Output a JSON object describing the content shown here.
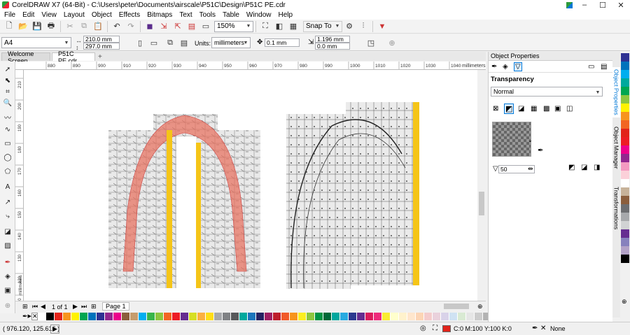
{
  "window": {
    "title": "CorelDRAW X7 (64-Bit) - C:\\Users\\peter\\Documents\\airscale\\P51C\\Design\\P51C PE.cdr"
  },
  "menu": [
    "File",
    "Edit",
    "View",
    "Layout",
    "Object",
    "Effects",
    "Bitmaps",
    "Text",
    "Tools",
    "Table",
    "Window",
    "Help"
  ],
  "toolbar": {
    "zoom": "150%",
    "snap_label": "Snap To"
  },
  "property_bar": {
    "page_size": "A4",
    "width": "210.0 mm",
    "height": "297.0 mm",
    "units_label": "Units:",
    "units": "millimeters",
    "nudge": "0.1 mm",
    "dup_x": "1.196 mm",
    "dup_y": "0.0 mm"
  },
  "tabs": [
    "Welcome Screen",
    "P51C PE.cdr"
  ],
  "ruler": {
    "h_labels": [
      "880",
      "890",
      "900",
      "910",
      "920",
      "930",
      "940",
      "950",
      "960",
      "970",
      "980",
      "990",
      "1000",
      "1010",
      "1020",
      "1030",
      "1040"
    ],
    "h_unit": "millimeters",
    "v_labels": [
      "210",
      "200",
      "190",
      "180",
      "170",
      "160",
      "150",
      "140",
      "130",
      "120",
      "110"
    ],
    "v_unit": "millimeters"
  },
  "page_nav": {
    "counter": "1 of 1",
    "page_tab": "Page 1"
  },
  "status": {
    "coords": "( 976.120, 125.616 )",
    "fill": "C:0 M:100 Y:100 K:0",
    "outline": "None"
  },
  "docker": {
    "title": "Object Properties",
    "section": "Transparency",
    "mode": "Normal",
    "opacity": "50"
  },
  "side_tabs": [
    "Object Properties",
    "Object Manager",
    "Transformations"
  ],
  "palette_bottom": [
    "#ffffff",
    "#000000",
    "#e2231a",
    "#f7941d",
    "#fff200",
    "#00a651",
    "#0072bc",
    "#2e3192",
    "#92278f",
    "#ec008c",
    "#8b5e3c",
    "#c69c6d",
    "#00aeef",
    "#39b54a",
    "#8dc63f",
    "#f26522",
    "#ed1c24",
    "#662d91",
    "#d7df23",
    "#fbb040",
    "#ffde17",
    "#a7a9ac",
    "#808285",
    "#58595b",
    "#00a99d",
    "#1b75bc",
    "#262262",
    "#9e1f63",
    "#be1e2d",
    "#f15a29",
    "#f7941d",
    "#fcee21",
    "#8cc63f",
    "#009444",
    "#006838",
    "#00a79d",
    "#27aae1",
    "#2b3990",
    "#652d90",
    "#da1c5c",
    "#ee2a7b",
    "#f9ed32",
    "#ffffcc",
    "#fff2cc",
    "#ffe6cc",
    "#fcd5b5",
    "#f4cccc",
    "#ead1dc",
    "#d9d2e9",
    "#cfe2f3",
    "#d9ead3",
    "#e6e6e6",
    "#cccccc",
    "#b3b3b3",
    "#999999",
    "#666666",
    "#4d4d4d",
    "#333333",
    "#1a1a1a",
    "#ffffff",
    "#f2f2f2",
    "#e0c8a0",
    "#c8a064"
  ],
  "palette_right": [
    "#2e3192",
    "#0072bc",
    "#00aeef",
    "#00a99d",
    "#00a651",
    "#8dc63f",
    "#fff200",
    "#f7941d",
    "#f26522",
    "#e2231a",
    "#ed1c24",
    "#ec008c",
    "#92278f",
    "#f49ac1",
    "#fbd0d9",
    "#ffffff",
    "#c7b299",
    "#8b5e3c",
    "#6d6e71",
    "#a7a9ac",
    "#d1d3d4",
    "#662d91",
    "#8781bd",
    "#b3a2c7",
    "#000000"
  ],
  "colors": {
    "accent": "#0078d7",
    "fill_indicator": "#e2231a",
    "tape": "#f5c518"
  }
}
